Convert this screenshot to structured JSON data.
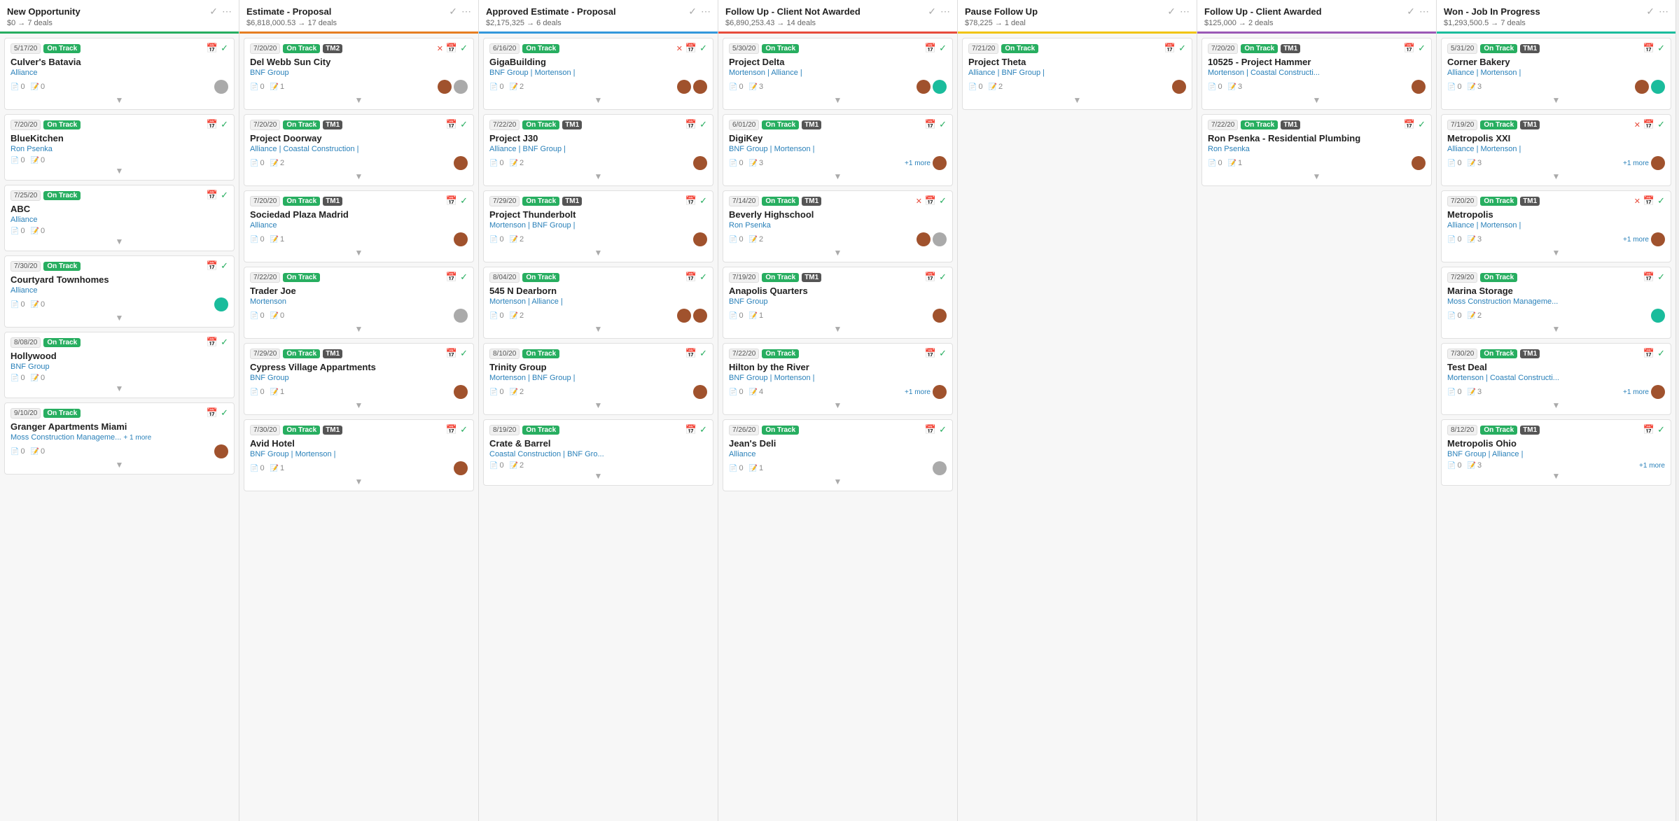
{
  "columns": [
    {
      "id": "new-opportunity",
      "title": "New Opportunity",
      "meta": "$0 → 7 deals",
      "color": "green",
      "cards": [
        {
          "date": "5/17/20",
          "status": "On Track",
          "status_color": "green",
          "tags": [],
          "title": "Culver's Batavia",
          "company": "Alliance",
          "counts": [
            0,
            0
          ],
          "avatars": [
            "gray"
          ],
          "has_collapse": true
        },
        {
          "date": "7/20/20",
          "status": "On Track",
          "status_color": "green",
          "tags": [],
          "title": "BlueKitchen",
          "company": "Ron Psenka",
          "counts": [
            0,
            0
          ],
          "avatars": [],
          "has_collapse": true
        },
        {
          "date": "7/25/20",
          "status": "On Track",
          "status_color": "green",
          "tags": [],
          "title": "ABC",
          "company": "Alliance",
          "counts": [
            0,
            0
          ],
          "avatars": [],
          "has_collapse": true
        },
        {
          "date": "7/30/20",
          "status": "On Track",
          "status_color": "green",
          "tags": [],
          "title": "Courtyard Townhomes",
          "company": "Alliance",
          "counts": [
            0,
            0
          ],
          "avatars": [
            "teal"
          ],
          "has_collapse": true
        },
        {
          "date": "8/08/20",
          "status": "On Track",
          "status_color": "green",
          "tags": [],
          "title": "Hollywood",
          "company": "BNF Group",
          "counts": [
            0,
            0
          ],
          "avatars": [],
          "has_collapse": true
        },
        {
          "date": "9/10/20",
          "status": "On Track",
          "status_color": "green",
          "tags": [],
          "title": "Granger Apartments Miami",
          "company": "Moss Construction Manageme... +1 more",
          "counts": [
            0,
            0
          ],
          "avatars": [
            "brown"
          ],
          "has_collapse": true
        }
      ]
    },
    {
      "id": "estimate-proposal",
      "title": "Estimate - Proposal",
      "meta": "$6,818,000.53 → 17 deals",
      "color": "orange",
      "cards": [
        {
          "date": "7/20/20",
          "status": "On Track",
          "status_color": "green",
          "tags": [
            "TM2"
          ],
          "title": "Del Webb Sun City",
          "company": "BNF Group",
          "counts": [
            0,
            1
          ],
          "avatars": [
            "brown",
            "gray"
          ],
          "has_collapse": true,
          "has_x": true
        },
        {
          "date": "7/20/20",
          "status": "On Track",
          "status_color": "green",
          "tags": [
            "TM1"
          ],
          "title": "Project Doorway",
          "company": "Alliance | Coastal Construction |",
          "counts": [
            0,
            2
          ],
          "avatars": [
            "brown"
          ],
          "has_collapse": true
        },
        {
          "date": "7/20/20",
          "status": "On Track",
          "status_color": "green",
          "tags": [
            "TM1"
          ],
          "title": "Sociedad Plaza Madrid",
          "company": "Alliance",
          "counts": [
            0,
            1
          ],
          "avatars": [
            "brown"
          ],
          "has_collapse": true
        },
        {
          "date": "7/22/20",
          "status": "On Track",
          "status_color": "green",
          "tags": [],
          "title": "Trader Joe",
          "company": "Mortenson",
          "counts": [
            0,
            0
          ],
          "avatars": [
            "gray"
          ],
          "has_collapse": true
        },
        {
          "date": "7/29/20",
          "status": "On Track",
          "status_color": "green",
          "tags": [
            "TM1"
          ],
          "title": "Cypress Village Appartments",
          "company": "BNF Group",
          "counts": [
            0,
            1
          ],
          "avatars": [
            "brown"
          ],
          "has_collapse": true
        },
        {
          "date": "7/30/20",
          "status": "On Track",
          "status_color": "green",
          "tags": [
            "TM1"
          ],
          "title": "Avid Hotel",
          "company": "BNF Group | Mortenson |",
          "counts": [
            0,
            1
          ],
          "avatars": [
            "brown"
          ],
          "has_collapse": true
        }
      ]
    },
    {
      "id": "approved-estimate",
      "title": "Approved Estimate - Proposal",
      "meta": "$2,175,325 → 6 deals",
      "color": "blue",
      "cards": [
        {
          "date": "6/16/20",
          "status": "On Track",
          "status_color": "green",
          "tags": [],
          "title": "GigaBuilding",
          "company": "BNF Group | Mortenson |",
          "counts": [
            0,
            2
          ],
          "avatars": [
            "brown",
            "brown"
          ],
          "has_collapse": true,
          "has_x": true
        },
        {
          "date": "7/22/20",
          "status": "On Track",
          "status_color": "green",
          "tags": [
            "TM1"
          ],
          "title": "Project J30",
          "company": "Alliance | BNF Group |",
          "counts": [
            0,
            2
          ],
          "avatars": [
            "brown"
          ],
          "has_collapse": true
        },
        {
          "date": "7/29/20",
          "status": "On Track",
          "status_color": "green",
          "tags": [
            "TM1"
          ],
          "title": "Project Thunderbolt",
          "company": "Mortenson | BNF Group |",
          "counts": [
            0,
            2
          ],
          "avatars": [
            "brown"
          ],
          "has_collapse": true
        },
        {
          "date": "8/04/20",
          "status": "On Track",
          "status_color": "green",
          "tags": [],
          "title": "545 N Dearborn",
          "company": "Mortenson | Alliance |",
          "counts": [
            0,
            2
          ],
          "avatars": [
            "brown",
            "brown"
          ],
          "has_collapse": true
        },
        {
          "date": "8/10/20",
          "status": "On Track",
          "status_color": "green",
          "tags": [],
          "title": "Trinity Group",
          "company": "Mortenson | BNF Group |",
          "counts": [
            0,
            2
          ],
          "avatars": [
            "brown"
          ],
          "has_collapse": true
        },
        {
          "date": "8/19/20",
          "status": "On Track",
          "status_color": "green",
          "tags": [],
          "title": "Crate & Barrel",
          "company": "Coastal Construction | BNF Gro...",
          "counts": [
            0,
            2
          ],
          "avatars": [],
          "has_collapse": true
        }
      ]
    },
    {
      "id": "follow-up-not-awarded",
      "title": "Follow Up - Client Not Awarded",
      "meta": "$6,890,253.43 → 14 deals",
      "color": "red",
      "cards": [
        {
          "date": "5/30/20",
          "status": "On Track",
          "status_color": "green",
          "tags": [],
          "title": "Project Delta",
          "company": "Mortenson | Alliance |",
          "counts": [
            0,
            3
          ],
          "avatars": [
            "brown",
            "teal"
          ],
          "has_collapse": true
        },
        {
          "date": "6/01/20",
          "status": "On Track",
          "status_color": "green",
          "tags": [
            "TM1"
          ],
          "title": "DigiKey",
          "company": "BNF Group | Mortenson |",
          "counts": [
            0,
            3
          ],
          "avatars": [
            "brown"
          ],
          "has_collapse": true,
          "more": "+1 more"
        },
        {
          "date": "7/14/20",
          "status": "On Track",
          "status_color": "green",
          "tags": [
            "TM1"
          ],
          "title": "Beverly Highschool",
          "company": "Ron Psenka",
          "counts": [
            0,
            2
          ],
          "avatars": [
            "brown",
            "gray"
          ],
          "has_collapse": true,
          "has_x": true
        },
        {
          "date": "7/19/20",
          "status": "On Track",
          "status_color": "green",
          "tags": [
            "TM1"
          ],
          "title": "Anapolis Quarters",
          "company": "BNF Group",
          "counts": [
            0,
            1
          ],
          "avatars": [
            "brown"
          ],
          "has_collapse": true
        },
        {
          "date": "7/22/20",
          "status": "On Track",
          "status_color": "green",
          "tags": [],
          "title": "Hilton by the River",
          "company": "BNF Group | Mortenson |",
          "counts": [
            0,
            4
          ],
          "avatars": [
            "brown"
          ],
          "has_collapse": true,
          "more": "+1 more"
        },
        {
          "date": "7/26/20",
          "status": "On Track",
          "status_color": "green",
          "tags": [],
          "title": "Jean's Deli",
          "company": "Alliance",
          "counts": [
            0,
            1
          ],
          "avatars": [
            "gray"
          ],
          "has_collapse": true
        }
      ]
    },
    {
      "id": "pause-follow-up",
      "title": "Pause Follow Up",
      "meta": "$78,225 → 1 deal",
      "color": "yellow",
      "cards": [
        {
          "date": "7/21/20",
          "status": "On Track",
          "status_color": "green",
          "tags": [],
          "title": "Project Theta",
          "company": "Alliance | BNF Group |",
          "counts": [
            0,
            2
          ],
          "avatars": [
            "brown"
          ],
          "has_collapse": true
        }
      ]
    },
    {
      "id": "follow-up-awarded",
      "title": "Follow Up - Client Awarded",
      "meta": "$125,000 → 2 deals",
      "color": "purple",
      "cards": [
        {
          "date": "7/20/20",
          "status": "On Track",
          "status_color": "green",
          "tags": [
            "TM1"
          ],
          "title": "10525 - Project Hammer",
          "company": "Mortenson | Coastal Constructi...",
          "counts": [
            0,
            3
          ],
          "avatars": [
            "brown"
          ],
          "has_collapse": true
        },
        {
          "date": "7/22/20",
          "status": "On Track",
          "status_color": "green",
          "tags": [
            "TM1"
          ],
          "title": "Ron Psenka - Residential Plumbing",
          "company": "Ron Psenka",
          "counts": [
            0,
            1
          ],
          "avatars": [
            "brown"
          ],
          "has_collapse": true
        }
      ]
    },
    {
      "id": "won-job-in-progress",
      "title": "Won - Job In Progress",
      "meta": "$1,293,500.5 → 7 deals",
      "color": "teal",
      "cards": [
        {
          "date": "5/31/20",
          "status": "On Track",
          "status_color": "green",
          "tags": [
            "TM1"
          ],
          "title": "Corner Bakery",
          "company": "Alliance | Mortenson |",
          "counts": [
            0,
            3
          ],
          "avatars": [
            "brown",
            "teal"
          ],
          "has_collapse": true
        },
        {
          "date": "7/19/20",
          "status": "On Track",
          "status_color": "green",
          "tags": [
            "TM1"
          ],
          "title": "Metropolis XXI",
          "company": "Alliance | Mortenson |",
          "counts": [
            0,
            3
          ],
          "avatars": [
            "brown"
          ],
          "has_collapse": true,
          "more": "+1 more",
          "has_x": true
        },
        {
          "date": "7/20/20",
          "status": "On Track",
          "status_color": "green",
          "tags": [
            "TM1"
          ],
          "title": "Metropolis",
          "company": "Alliance | Mortenson |",
          "counts": [
            0,
            3
          ],
          "avatars": [
            "brown"
          ],
          "has_collapse": true,
          "more": "+1 more",
          "has_x": true
        },
        {
          "date": "7/29/20",
          "status": "On Track",
          "status_color": "green",
          "tags": [],
          "title": "Marina Storage",
          "company": "Moss Construction Manageme...",
          "counts": [
            0,
            2
          ],
          "avatars": [
            "teal"
          ],
          "has_collapse": true
        },
        {
          "date": "7/30/20",
          "status": "On Track",
          "status_color": "green",
          "tags": [
            "TM1"
          ],
          "title": "Test Deal",
          "company": "Mortenson | Coastal Constructi...",
          "counts": [
            0,
            3
          ],
          "avatars": [
            "brown"
          ],
          "has_collapse": true,
          "more": "+1 more"
        },
        {
          "date": "8/12/20",
          "status": "On Track",
          "status_color": "green",
          "tags": [
            "TM1"
          ],
          "title": "Metropolis Ohio",
          "company": "BNF Group | Alliance |",
          "counts": [
            0,
            3
          ],
          "avatars": [],
          "has_collapse": true,
          "more": "+1 more"
        }
      ]
    }
  ],
  "ui": {
    "collapse_arrow": "▼",
    "calendar_icon": "📅",
    "check_icon": "✓",
    "x_icon": "✕",
    "more_icon": "⋯",
    "doc_icon": "📄",
    "note_icon": "📝",
    "avatar_initials": {
      "brown": "👤",
      "teal": "",
      "gray": ""
    }
  }
}
